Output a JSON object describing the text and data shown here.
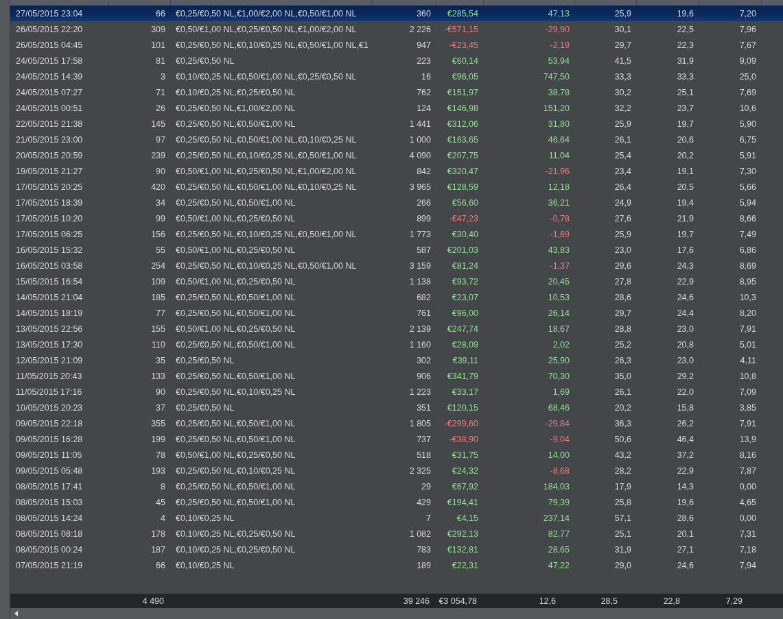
{
  "rows": [
    {
      "selected": true,
      "cells": [
        "27/05/2015 23:04",
        "66",
        "€0,25/€0,50 NL,€1,00/€2,00 NL,€0,50/€1,00 NL",
        "360",
        "€285,54",
        "47,13",
        "25,9",
        "19,6",
        "7,20"
      ],
      "eur": {
        "color": "#90e090"
      },
      "rate": {
        "color": "#90e090"
      }
    },
    {
      "selected": false,
      "cells": [
        "26/05/2015 22:20",
        "309",
        "€0,50/€1,00 NL,€0,25/€0,50 NL,€1,00/€2,00 NL",
        "2 226",
        "-€571,15",
        "-29,90",
        "30,1",
        "22,5",
        "7,96"
      ],
      "eur": {
        "color": "#f07878"
      },
      "rate": {
        "color": "#f07878"
      }
    },
    {
      "selected": false,
      "cells": [
        "26/05/2015 04:45",
        "101",
        "€0,25/€0,50 NL,€0,10/€0,25 NL,€0,50/€1,00 NL,€1",
        "947",
        "-€23,45",
        "-2,19",
        "29,7",
        "22,3",
        "7,67"
      ],
      "eur": {
        "color": "#f07878"
      },
      "rate": {
        "color": "#f07878"
      }
    },
    {
      "selected": false,
      "cells": [
        "24/05/2015 17:58",
        "81",
        "€0,25/€0,50 NL",
        "223",
        "€60,14",
        "53,94",
        "41,5",
        "31,9",
        "9,09"
      ],
      "eur": {
        "color": "#90e090"
      },
      "rate": {
        "color": "#90e090"
      }
    },
    {
      "selected": false,
      "cells": [
        "24/05/2015 14:39",
        "3",
        "€0,10/€0,25 NL,€0,50/€1,00 NL,€0,25/€0,50 NL",
        "16",
        "€96,05",
        "747,50",
        "33,3",
        "33,3",
        "25,0"
      ],
      "eur": {
        "color": "#90e090"
      },
      "rate": {
        "color": "#90e090"
      }
    },
    {
      "selected": false,
      "cells": [
        "24/05/2015 07:27",
        "71",
        "€0,10/€0,25 NL,€0,25/€0,50 NL",
        "762",
        "€151,97",
        "38,78",
        "30,2",
        "25,1",
        "7,69"
      ],
      "eur": {
        "color": "#90e090"
      },
      "rate": {
        "color": "#90e090"
      }
    },
    {
      "selected": false,
      "cells": [
        "24/05/2015 00:51",
        "26",
        "€0,25/€0,50 NL,€1,00/€2,00 NL",
        "124",
        "€146,98",
        "151,20",
        "32,2",
        "23,7",
        "10,6"
      ],
      "eur": {
        "color": "#90e090"
      },
      "rate": {
        "color": "#90e090"
      }
    },
    {
      "selected": false,
      "cells": [
        "22/05/2015 21:38",
        "145",
        "€0,25/€0,50 NL,€0,50/€1,00 NL",
        "1 441",
        "€312,06",
        "31,80",
        "25,9",
        "19,7",
        "5,90"
      ],
      "eur": {
        "color": "#90e090"
      },
      "rate": {
        "color": "#90e090"
      }
    },
    {
      "selected": false,
      "cells": [
        "21/05/2015 23:00",
        "97",
        "€0,25/€0,50 NL,€0,50/€1,00 NL,€0,10/€0,25 NL",
        "1 000",
        "€163,65",
        "46,64",
        "26,1",
        "20,6",
        "6,75"
      ],
      "eur": {
        "color": "#90e090"
      },
      "rate": {
        "color": "#90e090"
      }
    },
    {
      "selected": false,
      "cells": [
        "20/05/2015 20:59",
        "239",
        "€0,25/€0,50 NL,€0,10/€0,25 NL,€0,50/€1,00 NL",
        "4 090",
        "€207,75",
        "11,04",
        "25,4",
        "20,2",
        "5,91"
      ],
      "eur": {
        "color": "#90e090"
      },
      "rate": {
        "color": "#90e090"
      }
    },
    {
      "selected": false,
      "cells": [
        "19/05/2015 21:27",
        "90",
        "€0,50/€1,00 NL,€0,25/€0,50 NL,€1,00/€2,00 NL",
        "842",
        "€320,47",
        "-21,96",
        "23,4",
        "19,1",
        "7,30"
      ],
      "eur": {
        "color": "#90e090"
      },
      "rate": {
        "color": "#f07878"
      }
    },
    {
      "selected": false,
      "cells": [
        "17/05/2015 20:25",
        "420",
        "€0,25/€0,50 NL,€0,50/€1,00 NL,€0,10/€0,25 NL",
        "3 965",
        "€128,59",
        "12,18",
        "26,4",
        "20,5",
        "5,66"
      ],
      "eur": {
        "color": "#90e090"
      },
      "rate": {
        "color": "#90e090"
      }
    },
    {
      "selected": false,
      "cells": [
        "17/05/2015 18:39",
        "34",
        "€0,25/€0,50 NL,€0,50/€1,00 NL",
        "266",
        "€56,60",
        "36,21",
        "24,9",
        "19,4",
        "5,94"
      ],
      "eur": {
        "color": "#90e090"
      },
      "rate": {
        "color": "#90e090"
      }
    },
    {
      "selected": false,
      "cells": [
        "17/05/2015 10:20",
        "99",
        "€0,50/€1,00 NL,€0,25/€0,50 NL",
        "899",
        "-€47,23",
        "-0,78",
        "27,6",
        "21,9",
        "8,66"
      ],
      "eur": {
        "color": "#f07878"
      },
      "rate": {
        "color": "#f07878"
      }
    },
    {
      "selected": false,
      "cells": [
        "17/05/2015 06:25",
        "156",
        "€0,25/€0,50 NL,€0,10/€0,25 NL,€0,50/€1,00 NL",
        "1 773",
        "€30,40",
        "-1,69",
        "25,9",
        "19,7",
        "7,49"
      ],
      "eur": {
        "color": "#90e090"
      },
      "rate": {
        "color": "#f07878"
      }
    },
    {
      "selected": false,
      "cells": [
        "16/05/2015 15:32",
        "55",
        "€0,50/€1,00 NL,€0,25/€0,50 NL",
        "587",
        "€201,03",
        "43,83",
        "23,0",
        "17,6",
        "6,86"
      ],
      "eur": {
        "color": "#90e090"
      },
      "rate": {
        "color": "#90e090"
      }
    },
    {
      "selected": false,
      "cells": [
        "16/05/2015 03:58",
        "254",
        "€0,25/€0,50 NL,€0,10/€0,25 NL,€0,50/€1,00 NL",
        "3 159",
        "€81,24",
        "-1,37",
        "29,6",
        "24,3",
        "8,69"
      ],
      "eur": {
        "color": "#90e090"
      },
      "rate": {
        "color": "#f07878"
      }
    },
    {
      "selected": false,
      "cells": [
        "15/05/2015 16:54",
        "109",
        "€0,50/€1,00 NL,€0,25/€0,50 NL",
        "1 138",
        "€93,72",
        "20,45",
        "27,8",
        "22,9",
        "8,95"
      ],
      "eur": {
        "color": "#90e090"
      },
      "rate": {
        "color": "#90e090"
      }
    },
    {
      "selected": false,
      "cells": [
        "14/05/2015 21:04",
        "185",
        "€0,25/€0,50 NL,€0,50/€1,00 NL",
        "682",
        "€23,07",
        "10,53",
        "28,6",
        "24,6",
        "10,3"
      ],
      "eur": {
        "color": "#90e090"
      },
      "rate": {
        "color": "#90e090"
      }
    },
    {
      "selected": false,
      "cells": [
        "14/05/2015 18:19",
        "77",
        "€0,25/€0,50 NL,€0,50/€1,00 NL",
        "761",
        "€96,00",
        "26,14",
        "29,7",
        "24,4",
        "8,20"
      ],
      "eur": {
        "color": "#90e090"
      },
      "rate": {
        "color": "#90e090"
      }
    },
    {
      "selected": false,
      "cells": [
        "13/05/2015 22:56",
        "155",
        "€0,50/€1,00 NL,€0,25/€0,50 NL",
        "2 139",
        "€247,74",
        "18,67",
        "28,8",
        "23,0",
        "7,91"
      ],
      "eur": {
        "color": "#90e090"
      },
      "rate": {
        "color": "#90e090"
      }
    },
    {
      "selected": false,
      "cells": [
        "13/05/2015 17:30",
        "110",
        "€0,25/€0,50 NL,€0,50/€1,00 NL",
        "1 160",
        "€28,09",
        "2,02",
        "25,2",
        "20,8",
        "5,01"
      ],
      "eur": {
        "color": "#90e090"
      },
      "rate": {
        "color": "#90e090"
      }
    },
    {
      "selected": false,
      "cells": [
        "12/05/2015 21:09",
        "35",
        "€0,25/€0,50 NL",
        "302",
        "€39,11",
        "25,90",
        "26,3",
        "23,0",
        "4,11"
      ],
      "eur": {
        "color": "#90e090"
      },
      "rate": {
        "color": "#90e090"
      }
    },
    {
      "selected": false,
      "cells": [
        "11/05/2015 20:43",
        "133",
        "€0,25/€0,50 NL,€0,50/€1,00 NL",
        "906",
        "€341,79",
        "70,30",
        "35,0",
        "29,2",
        "10,8"
      ],
      "eur": {
        "color": "#90e090"
      },
      "rate": {
        "color": "#90e090"
      }
    },
    {
      "selected": false,
      "cells": [
        "11/05/2015 17:16",
        "90",
        "€0,25/€0,50 NL,€0,10/€0,25 NL",
        "1 223",
        "€33,17",
        "1,69",
        "26,1",
        "22,0",
        "7,09"
      ],
      "eur": {
        "color": "#90e090"
      },
      "rate": {
        "color": "#90e090"
      }
    },
    {
      "selected": false,
      "cells": [
        "10/05/2015 20:23",
        "37",
        "€0,25/€0,50 NL",
        "351",
        "€120,15",
        "68,46",
        "20,2",
        "15,8",
        "3,85"
      ],
      "eur": {
        "color": "#90e090"
      },
      "rate": {
        "color": "#90e090"
      }
    },
    {
      "selected": false,
      "cells": [
        "09/05/2015 22:18",
        "355",
        "€0,25/€0,50 NL,€0,50/€1,00 NL",
        "1 805",
        "-€299,60",
        "-29,84",
        "36,3",
        "26,2",
        "7,91"
      ],
      "eur": {
        "color": "#f07878"
      },
      "rate": {
        "color": "#f07878"
      }
    },
    {
      "selected": false,
      "cells": [
        "09/05/2015 16:28",
        "199",
        "€0,25/€0,50 NL,€0,50/€1,00 NL",
        "737",
        "-€38,90",
        "-9,04",
        "50,6",
        "46,4",
        "13,9"
      ],
      "eur": {
        "color": "#f07878"
      },
      "rate": {
        "color": "#f07878"
      }
    },
    {
      "selected": false,
      "cells": [
        "09/05/2015 11:05",
        "78",
        "€0,50/€1,00 NL,€0,25/€0,50 NL",
        "518",
        "€31,75",
        "14,00",
        "43,2",
        "37,2",
        "8,16"
      ],
      "eur": {
        "color": "#90e090"
      },
      "rate": {
        "color": "#90e090"
      }
    },
    {
      "selected": false,
      "cells": [
        "09/05/2015 05:48",
        "193",
        "€0,25/€0,50 NL,€0,10/€0,25 NL",
        "2 325",
        "€24,32",
        "-8,68",
        "28,2",
        "22,9",
        "7,87"
      ],
      "eur": {
        "color": "#90e090"
      },
      "rate": {
        "color": "#f07878"
      }
    },
    {
      "selected": false,
      "cells": [
        "08/05/2015 17:41",
        "8",
        "€0,25/€0,50 NL,€0,50/€1,00 NL",
        "29",
        "€67,92",
        "184,03",
        "17,9",
        "14,3",
        "0,00"
      ],
      "eur": {
        "color": "#90e090"
      },
      "rate": {
        "color": "#90e090"
      }
    },
    {
      "selected": false,
      "cells": [
        "08/05/2015 15:03",
        "45",
        "€0,25/€0,50 NL,€0,50/€1,00 NL",
        "429",
        "€194,41",
        "79,39",
        "25,8",
        "19,6",
        "4,65"
      ],
      "eur": {
        "color": "#90e090"
      },
      "rate": {
        "color": "#90e090"
      }
    },
    {
      "selected": false,
      "cells": [
        "08/05/2015 14:24",
        "4",
        "€0,10/€0,25 NL",
        "7",
        "€4,15",
        "237,14",
        "57,1",
        "28,6",
        "0,00"
      ],
      "eur": {
        "color": "#90e090"
      },
      "rate": {
        "color": "#90e090"
      }
    },
    {
      "selected": false,
      "cells": [
        "08/05/2015 08:18",
        "178",
        "€0,10/€0,25 NL,€0,25/€0,50 NL",
        "1 082",
        "€292,13",
        "82,77",
        "25,1",
        "20,1",
        "7,31"
      ],
      "eur": {
        "color": "#90e090"
      },
      "rate": {
        "color": "#90e090"
      }
    },
    {
      "selected": false,
      "cells": [
        "08/05/2015 00:24",
        "187",
        "€0,10/€0,25 NL,€0,25/€0,50 NL",
        "783",
        "€132,81",
        "28,65",
        "31,9",
        "27,1",
        "7,18"
      ],
      "eur": {
        "color": "#90e090"
      },
      "rate": {
        "color": "#90e090"
      }
    },
    {
      "selected": false,
      "cells": [
        "07/05/2015 21:19",
        "66",
        "€0,10/€0,25 NL",
        "189",
        "€22,31",
        "47,22",
        "29,0",
        "24,6",
        "7,94"
      ],
      "eur": {
        "color": "#90e090"
      },
      "rate": {
        "color": "#90e090"
      }
    }
  ],
  "totals": {
    "minutes": "4 490",
    "hands": "39 246",
    "eur": "€3 054,78",
    "column_6": "12,6",
    "column_7": "28,5",
    "column_8": "22,8",
    "column_9": "7,29"
  }
}
